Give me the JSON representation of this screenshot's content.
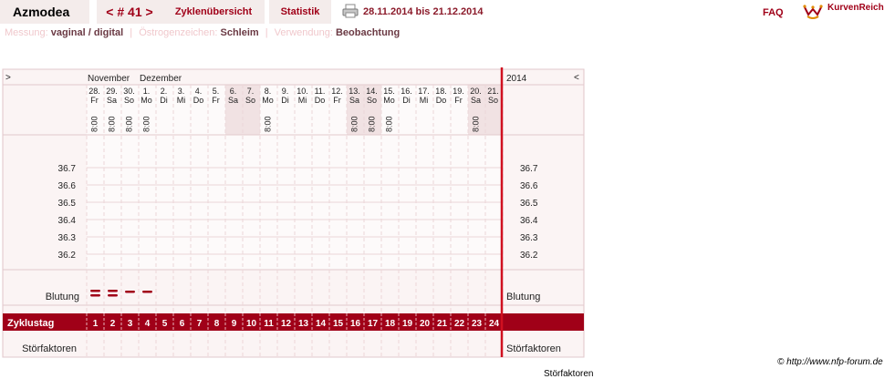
{
  "app": {
    "title": "Azmodea"
  },
  "cycle": {
    "prev": "<",
    "label": "# 41",
    "next": ">"
  },
  "nav": {
    "overview": "Zyklenübersicht",
    "stats": "Statistik"
  },
  "date_range": "28.11.2014 bis 21.12.2014",
  "faq": "FAQ",
  "logo_text": "KurvenReich",
  "info": {
    "measurement_label": "Messung:",
    "measurement_value": "vaginal / digital",
    "estrogen_label": "Östrogenzeichen:",
    "estrogen_value": "Schleim",
    "usage_label": "Verwendung:",
    "usage_value": "Beobachtung"
  },
  "chart": {
    "nav_left": ">",
    "nav_right": "<",
    "months": [
      "November",
      "Dezember"
    ],
    "year": "2014",
    "dates": [
      "28.",
      "29.",
      "30.",
      "1.",
      "2.",
      "3.",
      "4.",
      "5.",
      "6.",
      "7.",
      "8.",
      "9.",
      "10.",
      "11.",
      "12.",
      "13.",
      "14.",
      "15.",
      "16.",
      "17.",
      "18.",
      "19.",
      "20.",
      "21."
    ],
    "weekdays": [
      "Fr",
      "Sa",
      "So",
      "Mo",
      "Di",
      "Mi",
      "Do",
      "Fr",
      "Sa",
      "So",
      "Mo",
      "Di",
      "Mi",
      "Do",
      "Fr",
      "Sa",
      "So",
      "Mo",
      "Di",
      "Mi",
      "Do",
      "Fr",
      "Sa",
      "So"
    ],
    "times": [
      "8:00",
      "8:00",
      "8:00",
      "8:00",
      "",
      "",
      "",
      "",
      "",
      "",
      "8:00",
      "",
      "",
      "",
      "",
      "8:00",
      "8:00",
      "8:00",
      "",
      "",
      "",
      "",
      "8:00",
      ""
    ],
    "weekend_shaded": [
      false,
      false,
      false,
      false,
      false,
      false,
      false,
      false,
      true,
      true,
      false,
      false,
      false,
      false,
      false,
      true,
      true,
      false,
      false,
      false,
      false,
      false,
      true,
      true
    ],
    "temp_labels": [
      "36.7",
      "36.6",
      "36.5",
      "36.4",
      "36.3",
      "36.2"
    ],
    "bleeding_label": "Blutung",
    "bleeding": [
      "heavy",
      "heavy",
      "light",
      "light",
      "",
      "",
      "",
      "",
      "",
      "",
      "",
      "",
      "",
      "",
      "",
      "",
      "",
      "",
      "",
      "",
      "",
      "",
      "",
      ""
    ],
    "cycle_day_label": "Zyklustag",
    "cycle_days": [
      "1",
      "2",
      "3",
      "4",
      "5",
      "6",
      "7",
      "8",
      "9",
      "10",
      "11",
      "12",
      "13",
      "14",
      "15",
      "16",
      "17",
      "18",
      "19",
      "20",
      "21",
      "22",
      "23",
      "24"
    ],
    "disturbance_label": "Störfaktoren",
    "colors": {
      "accent": "#a00018",
      "grid": "#ecd6d8",
      "panel": "#fbf4f4"
    }
  },
  "credit": "© http://www.nfp-forum.de",
  "ghost_text": "Störfaktoren"
}
